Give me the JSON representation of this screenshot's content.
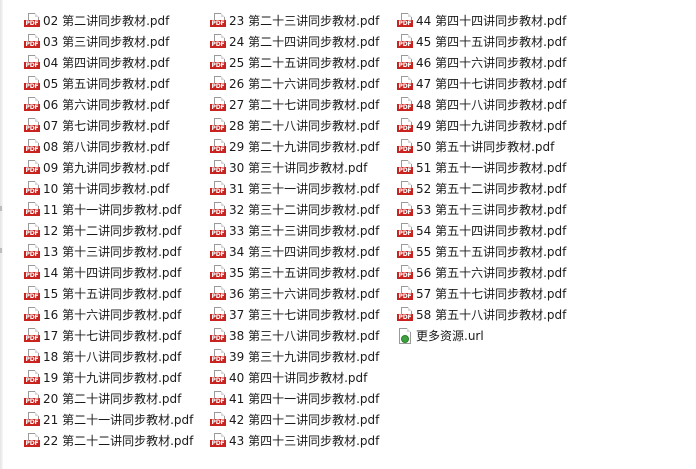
{
  "pdf_badge": "PDF",
  "files": [
    [
      "02 第二讲同步教材.pdf",
      "03 第三讲同步教材.pdf",
      "04 第四讲同步教材.pdf",
      "05 第五讲同步教材.pdf",
      "06 第六讲同步教材.pdf",
      "07 第七讲同步教材.pdf",
      "08 第八讲同步教材.pdf",
      "09 第九讲同步教材.pdf",
      "10 第十讲同步教材.pdf",
      "11 第十一讲同步教材.pdf",
      "12 第十二讲同步教材.pdf",
      "13 第十三讲同步教材.pdf",
      "14 第十四讲同步教材.pdf",
      "15 第十五讲同步教材.pdf",
      "16 第十六讲同步教材.pdf",
      "17 第十七讲同步教材.pdf",
      "18 第十八讲同步教材.pdf",
      "19 第十九讲同步教材.pdf",
      "20 第二十讲同步教材.pdf",
      "21 第二十一讲同步教材.pdf",
      "22 第二十二讲同步教材.pdf"
    ],
    [
      "23 第二十三讲同步教材.pdf",
      "24 第二十四讲同步教材.pdf",
      "25 第二十五讲同步教材.pdf",
      "26 第二十六讲同步教材.pdf",
      "27 第二十七讲同步教材.pdf",
      "28 第二十八讲同步教材.pdf",
      "29 第二十九讲同步教材.pdf",
      "30 第三十讲同步教材.pdf",
      "31 第三十一讲同步教材.pdf",
      "32 第三十二讲同步教材.pdf",
      "33 第三十三讲同步教材.pdf",
      "34 第三十四讲同步教材.pdf",
      "35 第三十五讲同步教材.pdf",
      "36 第三十六讲同步教材.pdf",
      "37 第三十七讲同步教材.pdf",
      "38 第三十八讲同步教材.pdf",
      "39 第三十九讲同步教材.pdf",
      "40 第四十讲同步教材.pdf",
      "41 第四十一讲同步教材.pdf",
      "42 第四十二讲同步教材.pdf",
      "43 第四十三讲同步教材.pdf"
    ],
    [
      "44 第四十四讲同步教材.pdf",
      "45 第四十五讲同步教材.pdf",
      "46 第四十六讲同步教材.pdf",
      "47 第四十七讲同步教材.pdf",
      "48 第四十八讲同步教材.pdf",
      "49 第四十九讲同步教材.pdf",
      "50 第五十讲同步教材.pdf",
      "51 第五十一讲同步教材.pdf",
      "52 第五十二讲同步教材.pdf",
      "53 第五十三讲同步教材.pdf",
      "54 第五十四讲同步教材.pdf",
      "55 第五十五讲同步教材.pdf",
      "56 第五十六讲同步教材.pdf",
      "57 第五十七讲同步教材.pdf",
      "58 第五十八讲同步教材.pdf",
      "更多资源.url"
    ]
  ]
}
